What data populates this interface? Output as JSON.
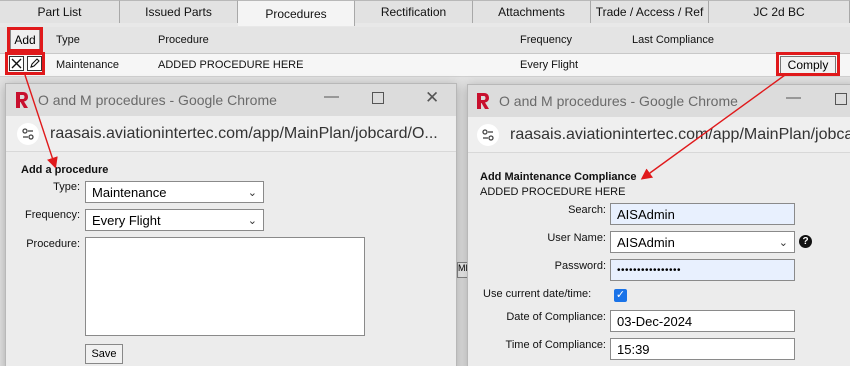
{
  "tabs": [
    "Part List",
    "Issued Parts",
    "Procedures",
    "Rectification",
    "Attachments",
    "Trade / Access / Ref",
    "JC 2d BC"
  ],
  "grid": {
    "add_label": "Add",
    "columns": {
      "type": "Type",
      "procedure": "Procedure",
      "frequency": "Frequency",
      "last_compliance": "Last Compliance"
    },
    "row": {
      "type": "Maintenance",
      "procedure": "ADDED PROCEDURE HERE",
      "frequency": "Every Flight",
      "comply_label": "Comply"
    },
    "partial_button": "MP"
  },
  "left_window": {
    "title": "O and M procedures - Google Chrome",
    "url": "raasais.aviationintertec.com/app/MainPlan/jobcard/O...",
    "heading": "Add a procedure",
    "type_label": "Type:",
    "type_value": "Maintenance",
    "frequency_label": "Frequency:",
    "frequency_value": "Every Flight",
    "procedure_label": "Procedure:",
    "save_label": "Save"
  },
  "right_window": {
    "title": "O and M procedures - Google Chrome",
    "url": "raasais.aviationintertec.com/app/MainPlan/jobcard",
    "heading": "Add Maintenance Compliance",
    "subheading": "ADDED PROCEDURE HERE",
    "search_label": "Search:",
    "search_value": "AISAdmin",
    "username_label": "User Name:",
    "username_value": "AISAdmin",
    "password_label": "Password:",
    "password_value": "••••••••••••••••",
    "use_current_label": "Use current date/time:",
    "date_label": "Date of Compliance:",
    "date_value": "03-Dec-2024",
    "time_label": "Time of Compliance:",
    "time_value": "15:39"
  },
  "colors": {
    "highlight": "#e0191b",
    "logo": "#c8102e",
    "checkbox": "#1a73e8",
    "autofill": "#e8f0fe"
  }
}
